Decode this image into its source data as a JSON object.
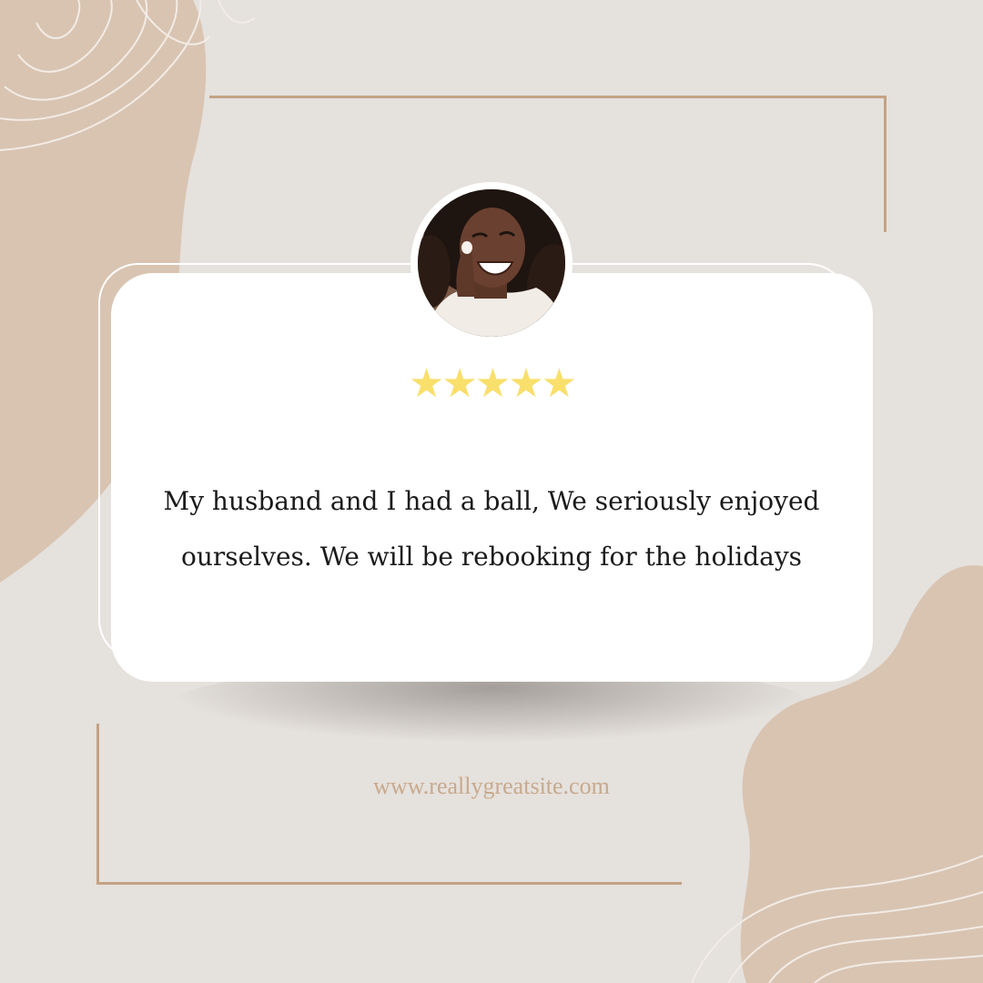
{
  "review": {
    "rating_stars": 5,
    "star_color": "#f9df6b",
    "quote_line_1": "My husband and I had a ball, We seriously enjoyed",
    "quote_line_2": "ourselves. We will be rebooking for the holidays"
  },
  "footer": {
    "website": "www.reallygreatsite.com"
  },
  "theme": {
    "background": "#e5e1dd",
    "accent_beige": "#d9c4b2",
    "frame_line": "#c4a284",
    "card": "#ffffff",
    "text": "#1b1b1b",
    "website_text": "#c8a98c"
  },
  "avatar": {
    "icon": "customer-portrait"
  }
}
